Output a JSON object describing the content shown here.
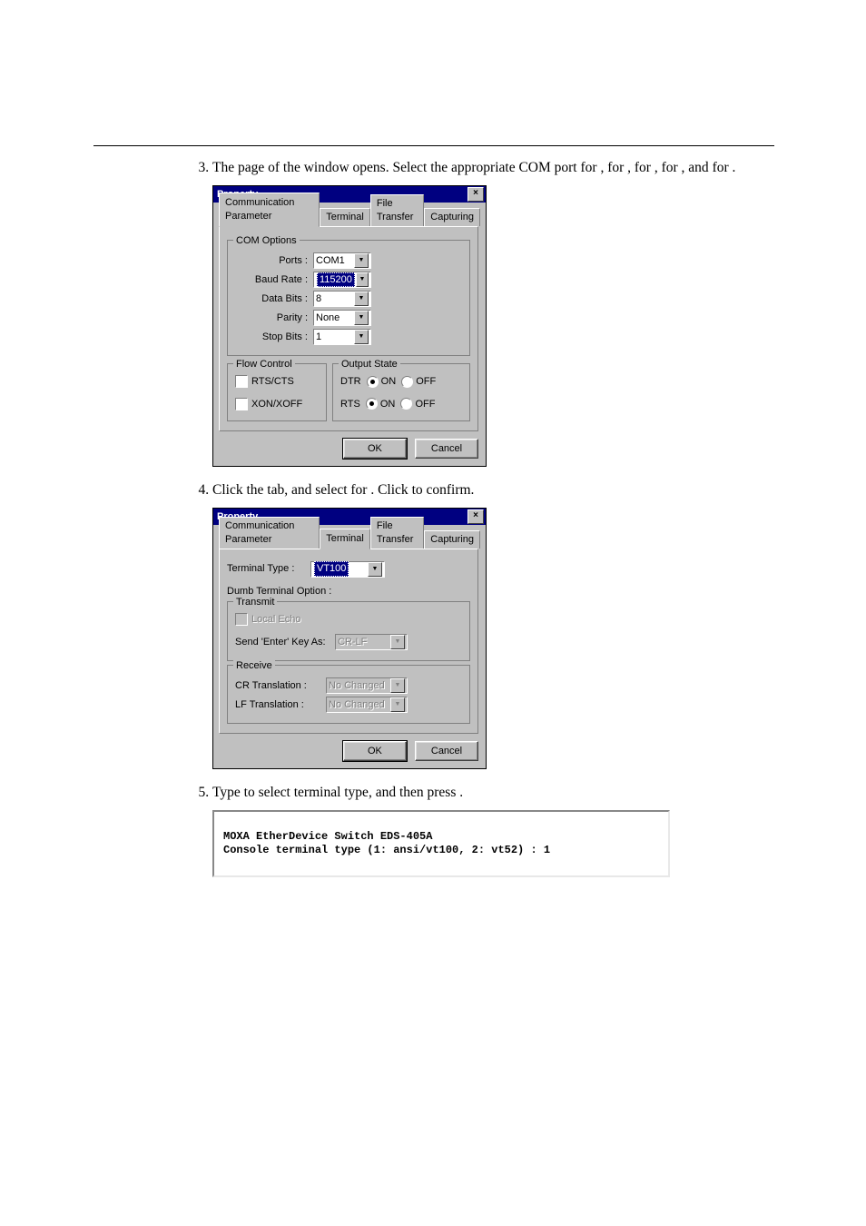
{
  "steps": {
    "s3": {
      "num": "3.",
      "text_parts": {
        "a": "The ",
        "b": " page of the ",
        "c": " window opens. Select the appropriate COM port for ",
        "d": ", ",
        "e": " for ",
        "f": ", ",
        "g": " for ",
        "h": ", ",
        "i": " for ",
        "j": ", and ",
        "k": " for ",
        "l": "."
      }
    },
    "s4": {
      "text_parts": {
        "a": "Click the ",
        "b": " tab, and select ",
        "c": " for ",
        "d": ". Click ",
        "e": " to confirm."
      }
    },
    "s5": {
      "text_parts": {
        "a": "Type ",
        "b": " to select ",
        "c": " terminal type, and then press ",
        "d": "."
      }
    }
  },
  "dlg1": {
    "title": "Property",
    "tabs": [
      "Communication Parameter",
      "Terminal",
      "File Transfer",
      "Capturing"
    ],
    "group_com": "COM Options",
    "labels": {
      "ports": "Ports :",
      "baud": "Baud Rate :",
      "databits": "Data Bits :",
      "parity": "Parity :",
      "stopbits": "Stop Bits :"
    },
    "values": {
      "ports": "COM1",
      "baud": "115200",
      "databits": "8",
      "parity": "None",
      "stopbits": "1"
    },
    "group_flow": "Flow Control",
    "chk_rtscts": "RTS/CTS",
    "chk_xon": "XON/XOFF",
    "group_output": "Output State",
    "out_dtr": "DTR",
    "out_rts": "RTS",
    "on": "ON",
    "off": "OFF",
    "ok": "OK",
    "cancel": "Cancel"
  },
  "dlg2": {
    "title": "Property",
    "tabs": [
      "Communication Parameter",
      "Terminal",
      "File Transfer",
      "Capturing"
    ],
    "termtype_lbl": "Terminal Type :",
    "termtype_val": "VT100",
    "dumb_lbl": "Dumb Terminal Option :",
    "group_tx": "Transmit",
    "chk_localecho": "Local Echo",
    "send_enter_lbl": "Send 'Enter' Key  As:",
    "send_enter_val": "CR-LF",
    "group_rx": "Receive",
    "cr_lbl": "CR Translation :",
    "lf_lbl": "LF Translation :",
    "nochange": "No Changed",
    "ok": "OK",
    "cancel": "Cancel"
  },
  "console": {
    "line1": "MOXA EtherDevice Switch EDS-405A",
    "line2": "Console terminal type (1: ansi/vt100, 2: vt52) : 1"
  }
}
